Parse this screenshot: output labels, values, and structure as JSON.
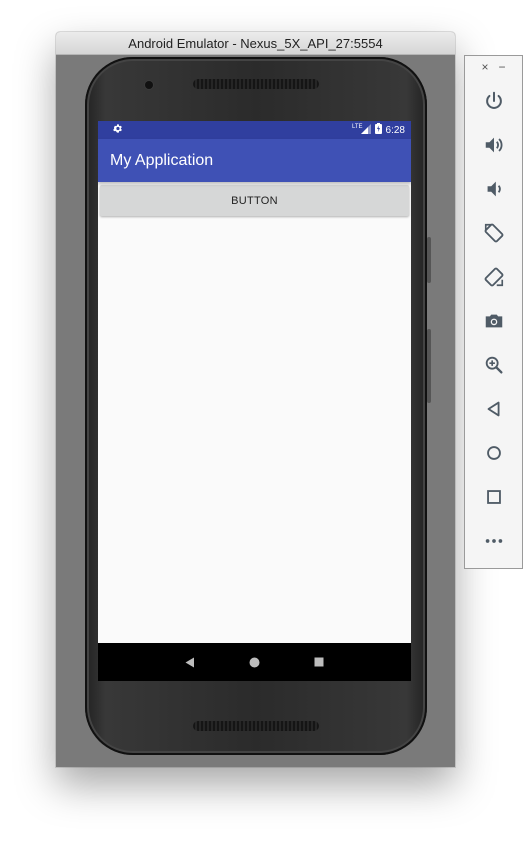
{
  "window": {
    "title": "Android Emulator - Nexus_5X_API_27:5554"
  },
  "status_bar": {
    "time": "6:28",
    "network_label": "LTE"
  },
  "app": {
    "title": "My Application",
    "button_label": "BUTTON"
  },
  "toolbar": {
    "close_glyph": "×",
    "minimize_glyph": "−",
    "items": [
      "power-icon",
      "volume-up-icon",
      "volume-down-icon",
      "rotate-left-icon",
      "rotate-right-icon",
      "camera-icon",
      "zoom-icon",
      "back-icon",
      "home-icon",
      "overview-icon",
      "more-icon"
    ]
  },
  "colors": {
    "status_bar": "#303f9f",
    "app_bar": "#3f51b5",
    "button": "#d6d7d7",
    "toolbar_icon": "#4f5b66"
  }
}
